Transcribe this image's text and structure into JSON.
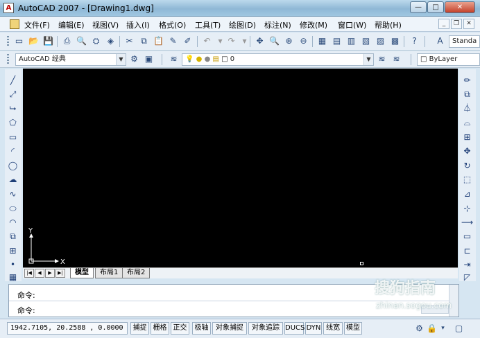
{
  "window": {
    "title": "AutoCAD 2007 - [Drawing1.dwg]",
    "controls": {
      "minimize": "—",
      "maximize": "□",
      "close": "✕"
    }
  },
  "menu": {
    "items": [
      "文件(F)",
      "编辑(E)",
      "视图(V)",
      "插入(I)",
      "格式(O)",
      "工具(T)",
      "绘图(D)",
      "标注(N)",
      "修改(M)",
      "窗口(W)",
      "帮助(H)"
    ],
    "mdi_controls": {
      "minimize": "_",
      "restore": "❐",
      "close": "✕"
    }
  },
  "toolbar": {
    "text_style_value": "Standa",
    "workspace_value": "AutoCAD 经典",
    "layer_value": "0",
    "color_value": "ByLayer"
  },
  "canvas": {
    "background": "#000000",
    "ucs_x_label": "X",
    "ucs_y_label": "Y"
  },
  "layout_tabs": {
    "tabs": [
      "模型",
      "布局1",
      "布局2"
    ],
    "active": "模型"
  },
  "command": {
    "line1": "命令:",
    "line2": "命令:"
  },
  "status": {
    "coordinates": "1942.7105, 20.2588 , 0.0000",
    "buttons": [
      "捕捉",
      "栅格",
      "正交",
      "极轴",
      "对象捕捉",
      "对象追踪",
      "DUCS",
      "DYN",
      "线宽",
      "模型"
    ]
  },
  "watermark": {
    "text": "搜狗指南",
    "url": "zhinan.sogou.com"
  }
}
